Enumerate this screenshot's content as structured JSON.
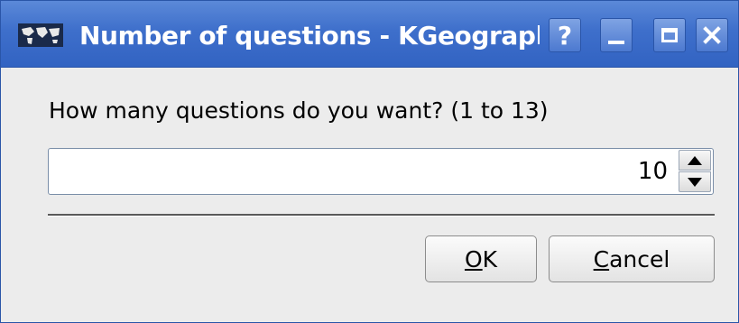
{
  "window": {
    "title": "Number of questions - KGeograpl",
    "icon": "world-map-icon",
    "controls": {
      "help_label": "?",
      "minimize_icon": "minimize-icon",
      "maximize_icon": "maximize-icon",
      "close_icon": "close-icon"
    }
  },
  "dialog": {
    "prompt": "How many questions do you want? (1 to 13)",
    "spinbox": {
      "value": "10",
      "min": 1,
      "max": 13
    },
    "buttons": {
      "ok_mnemonic": "O",
      "ok_rest": "K",
      "cancel_mnemonic": "C",
      "cancel_rest": "ancel"
    }
  },
  "colors": {
    "titlebar": "#3e6fcb",
    "window_bg": "#ececec",
    "title_text": "#ffffff"
  }
}
